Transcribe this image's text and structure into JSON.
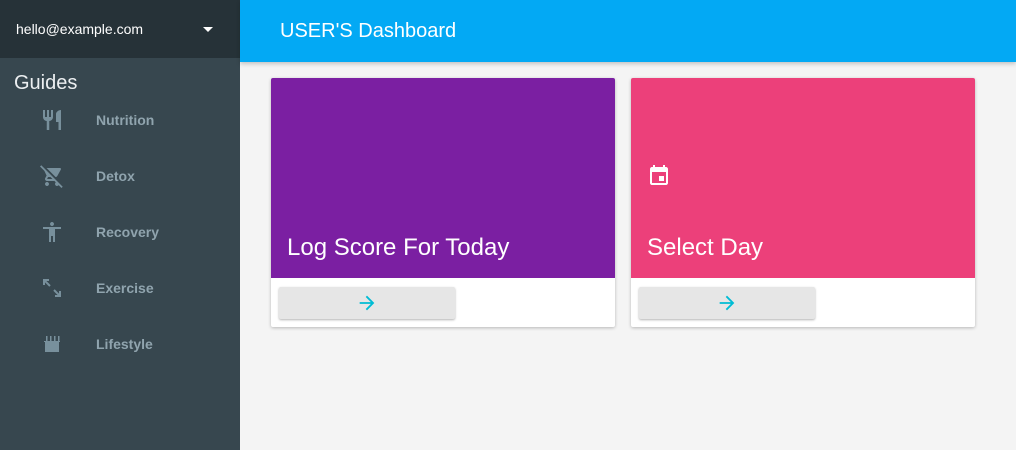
{
  "account": {
    "email": "hello@example.com",
    "menu_icon": "caret-down-icon"
  },
  "sidebar": {
    "heading": "Guides",
    "items": [
      {
        "label": "Nutrition",
        "icon": "restaurant-icon"
      },
      {
        "label": "Detox",
        "icon": "remove-shopping-cart-icon"
      },
      {
        "label": "Recovery",
        "icon": "accessibility-icon"
      },
      {
        "label": "Exercise",
        "icon": "compress-arrows-icon"
      },
      {
        "label": "Lifestyle",
        "icon": "kitchen-icon"
      }
    ]
  },
  "appbar": {
    "title": "USER'S Dashboard"
  },
  "cards": [
    {
      "title": "Log Score For Today",
      "color": "#7b1fa2",
      "action_icon": "arrow-forward-icon"
    },
    {
      "title": "Select Day",
      "color": "#ec407a",
      "media_icon": "calendar-icon",
      "action_icon": "arrow-forward-icon"
    }
  ],
  "colors": {
    "sidebar": "#37474f",
    "account_bar": "#263238",
    "appbar": "#03a9f4",
    "accent": "#00bcd4"
  }
}
